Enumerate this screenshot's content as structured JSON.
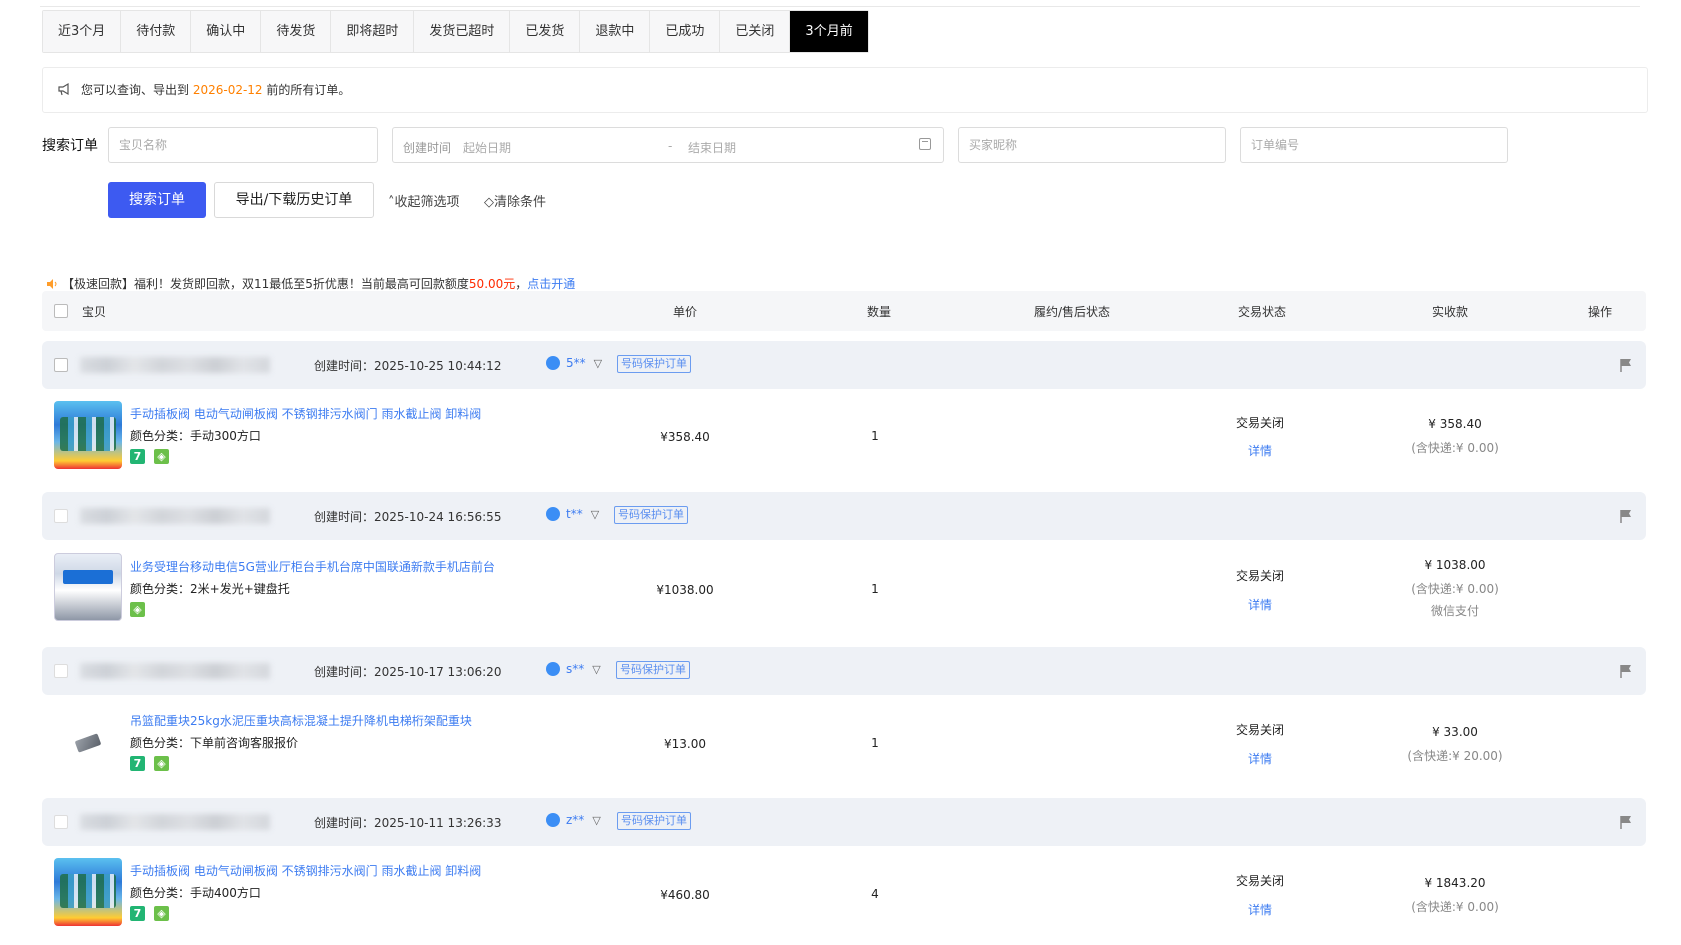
{
  "tabs": [
    "近3个月",
    "待付款",
    "确认中",
    "待发货",
    "即将超时",
    "发货已超时",
    "已发货",
    "退款中",
    "已成功",
    "已关闭",
    "3个月前"
  ],
  "active_tab_index": 10,
  "notice": {
    "prefix": "您可以查询、导出到 ",
    "date": "2026-02-12",
    "suffix": " 前的所有订单。"
  },
  "search": {
    "label": "搜索订单",
    "item_placeholder": "宝贝名称",
    "created_label": "创建时间",
    "start_placeholder": "起始日期",
    "separator": "-",
    "end_placeholder": "结束日期",
    "buyer_placeholder": "买家昵称",
    "order_placeholder": "订单编号",
    "search_button": "搜索订单",
    "export_button": "导出/下载历史订单",
    "collapse_link": "收起筛选项",
    "clear_link": "清除条件"
  },
  "promo": {
    "text1": "【极速回款】福利！发货即回款，双11最低至5折优惠！当前最高可回款额度",
    "amount": "50.00元",
    "text2": "，",
    "link": "点击开通"
  },
  "table_header": {
    "item": "宝贝",
    "price": "单价",
    "qty": "数量",
    "aftersale": "履约/售后状态",
    "status": "交易状态",
    "paid": "实收款",
    "action": "操作"
  },
  "orders": [
    {
      "created": "创建时间：2025-10-25 10:44:12",
      "buyer": "5**",
      "tag": "号码保护订单",
      "title": "手动插板阀 电动气动闸板阀 不锈钢排污水阀门 雨水截止阀 卸料阀",
      "spec": "颜色分类：手动300方口",
      "price": "¥358.40",
      "qty": "1",
      "status": "交易关闭",
      "detail": "详情",
      "paid": "¥ 358.40",
      "shipping": "(含快递:¥ 0.00)",
      "pay_method": ""
    },
    {
      "created": "创建时间：2025-10-24 16:56:55",
      "buyer": "t**",
      "tag": "号码保护订单",
      "title": "业务受理台移动电信5G营业厅柜台手机台席中国联通新款手机店前台",
      "spec": "颜色分类：2米+发光+键盘托",
      "price": "¥1038.00",
      "qty": "1",
      "status": "交易关闭",
      "detail": "详情",
      "paid": "¥ 1038.00",
      "shipping": "(含快递:¥ 0.00)",
      "pay_method": "微信支付"
    },
    {
      "created": "创建时间：2025-10-17 13:06:20",
      "buyer": "s**",
      "tag": "号码保护订单",
      "title": "吊篮配重块25kg水泥压重块高标混凝土提升降机电梯桁架配重块",
      "spec": "颜色分类：下单前咨询客服报价",
      "price": "¥13.00",
      "qty": "1",
      "status": "交易关闭",
      "detail": "详情",
      "paid": "¥ 33.00",
      "shipping": "(含快递:¥ 20.00)",
      "pay_method": ""
    },
    {
      "created": "创建时间：2025-10-11 13:26:33",
      "buyer": "z**",
      "tag": "号码保护订单",
      "title": "手动插板阀 电动气动闸板阀 不锈钢排污水阀门 雨水截止阀 卸料阀",
      "spec": "颜色分类：手动400方口",
      "price": "¥460.80",
      "qty": "4",
      "status": "交易关闭",
      "detail": "详情",
      "paid": "¥ 1843.20",
      "shipping": "(含快递:¥ 0.00)",
      "pay_method": ""
    }
  ],
  "badges": {
    "seven": "7"
  },
  "colors": {
    "primary": "#3d5af1",
    "link": "#3d7cf1",
    "warning": "#ff8000",
    "promo_red": "#ff2a00",
    "active_tab": "#000000"
  }
}
